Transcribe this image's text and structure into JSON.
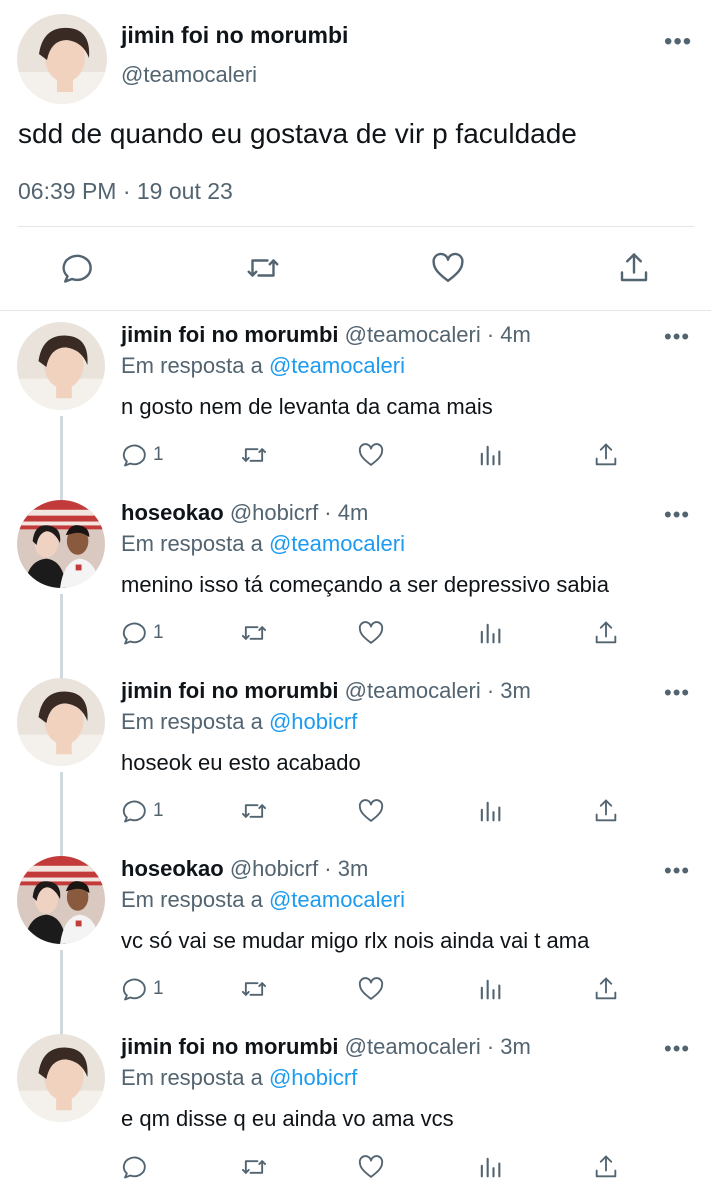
{
  "main_tweet": {
    "name": "jimin foi no morumbi",
    "handle": "@teamocaleri",
    "text": "sdd de quando eu gostava de vir p faculdade",
    "time": "06:39 PM · 19 out 23",
    "more": "•••",
    "actions": [
      "reply-icon",
      "retweet-icon",
      "like-icon",
      "share-icon"
    ]
  },
  "replies": [
    {
      "name": "jimin foi no morumbi",
      "handle_time": "@teamocaleri · 4m",
      "in_reply_prefix": "Em resposta a ",
      "mention": "@teamocaleri",
      "text": "n gosto nem de levanta da cama mais",
      "reply_count": "1"
    },
    {
      "name": "hoseokao",
      "handle_time": "@hobicrf · 4m",
      "in_reply_prefix": "Em resposta a ",
      "mention": "@teamocaleri",
      "text": "menino isso tá começando a ser depressivo sabia",
      "reply_count": "1"
    },
    {
      "name": "jimin foi no morumbi",
      "handle_time": "@teamocaleri · 3m",
      "in_reply_prefix": "Em resposta a ",
      "mention": "@hobicrf",
      "text": "hoseok eu esto acabado",
      "reply_count": "1"
    },
    {
      "name": "hoseokao",
      "handle_time": "@hobicrf · 3m",
      "in_reply_prefix": "Em resposta a ",
      "mention": "@teamocaleri",
      "text": "vc só vai se mudar migo rlx nois ainda vai t ama",
      "reply_count": "1"
    },
    {
      "name": "jimin foi no morumbi",
      "handle_time": "@teamocaleri · 3m",
      "in_reply_prefix": "Em resposta a ",
      "mention": "@hobicrf",
      "text": "e qm disse q eu ainda vo ama vcs",
      "reply_count": ""
    }
  ],
  "colors": {
    "text": "#0f1419",
    "muted": "#536471",
    "link": "#1d9bf0",
    "divider": "#e1e6ea"
  }
}
